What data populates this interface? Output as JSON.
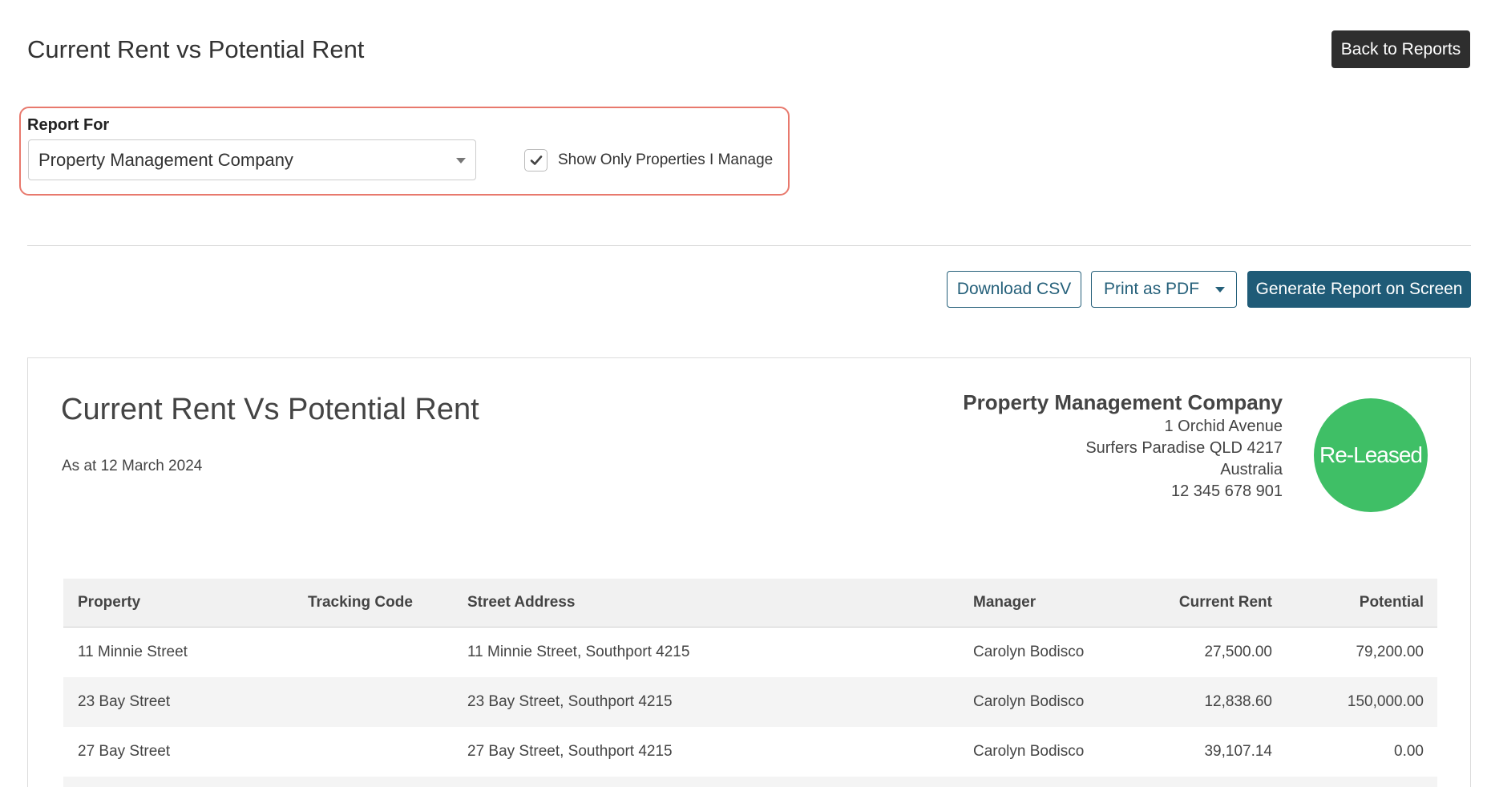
{
  "header": {
    "title": "Current Rent vs Potential Rent",
    "back_label": "Back to Reports"
  },
  "filters": {
    "report_for_label": "Report For",
    "report_for_value": "Property Management Company",
    "show_only_label": "Show Only Properties I Manage",
    "show_only_checked": true
  },
  "actions": {
    "download_csv": "Download CSV",
    "print_pdf": "Print as PDF",
    "generate": "Generate Report on Screen"
  },
  "report": {
    "title": "Current Rent Vs Potential Rent",
    "as_at": "As at 12 March 2024",
    "company": {
      "name": "Property Management Company",
      "address1": "1 Orchid Avenue",
      "address2": "Surfers Paradise QLD 4217",
      "country": "Australia",
      "phone": "12 345 678 901"
    },
    "logo_text": "Re-Leased",
    "logo_color": "#3fbf66"
  },
  "table": {
    "columns": {
      "property": "Property",
      "tracking_code": "Tracking Code",
      "street_address": "Street Address",
      "manager": "Manager",
      "current_rent": "Current Rent",
      "potential": "Potential"
    },
    "rows": [
      {
        "property": "11 Minnie Street",
        "tracking_code": "",
        "street_address": "11 Minnie Street, Southport 4215",
        "manager": "Carolyn Bodisco",
        "current_rent": "27,500.00",
        "potential": "79,200.00"
      },
      {
        "property": "23 Bay Street",
        "tracking_code": "",
        "street_address": "23 Bay Street, Southport 4215",
        "manager": "Carolyn Bodisco",
        "current_rent": "12,838.60",
        "potential": "150,000.00"
      },
      {
        "property": "27 Bay Street",
        "tracking_code": "",
        "street_address": "27 Bay Street, Southport 4215",
        "manager": "Carolyn Bodisco",
        "current_rent": "39,107.14",
        "potential": "0.00"
      }
    ]
  },
  "colors": {
    "primary": "#1f5b77",
    "highlight_border": "#e8796d",
    "dark_button": "#2e2e2e"
  }
}
